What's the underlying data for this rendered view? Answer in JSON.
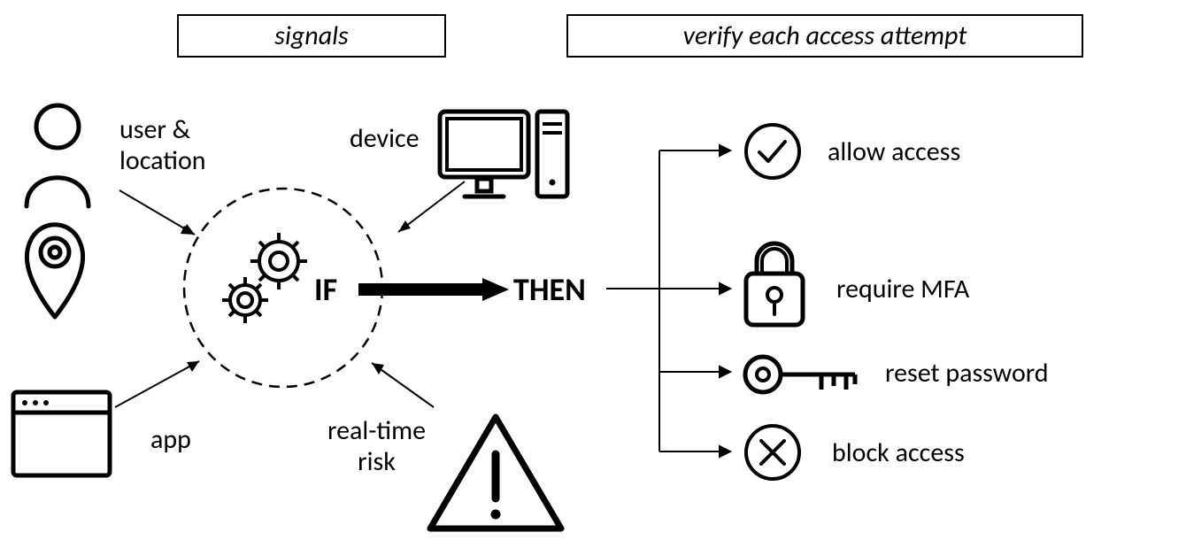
{
  "headers": {
    "left": "signals",
    "right": "verify each access attempt"
  },
  "signals": {
    "user_location": "user &\nlocation",
    "device": "device",
    "app": "app",
    "risk": "real-time\nrisk"
  },
  "engine": {
    "if": "IF",
    "then": "THEN"
  },
  "outcomes": {
    "allow": "allow access",
    "mfa": "require MFA",
    "reset": "reset password",
    "block": "block access"
  }
}
